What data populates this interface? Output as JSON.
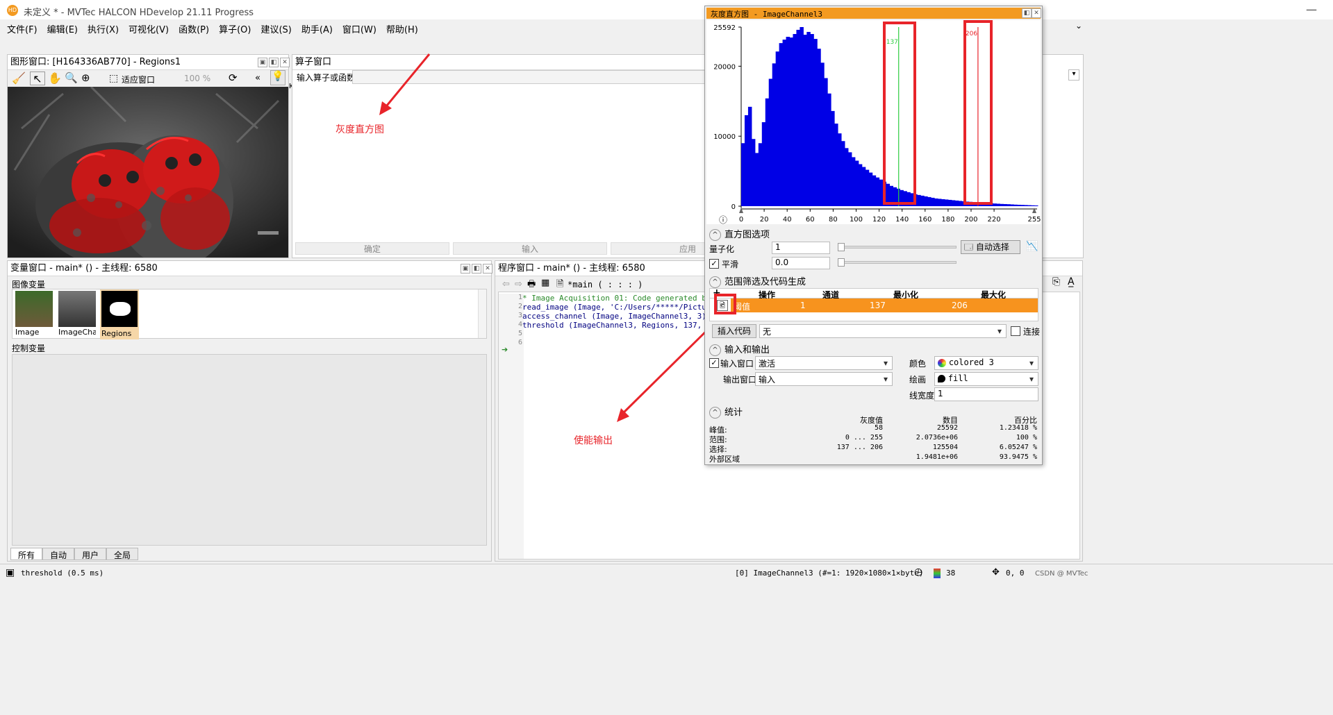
{
  "app": {
    "title": "未定义 * - MVTec HALCON HDevelop 21.11 Progress",
    "logo": "HD"
  },
  "menu": [
    "文件(F)",
    "编辑(E)",
    "执行(X)",
    "可视化(V)",
    "函数(P)",
    "算子(O)",
    "建议(S)",
    "助手(A)",
    "窗口(W)",
    "帮助(H)"
  ],
  "graphics": {
    "title": "图形窗口: [H164336AB770] - Regions1",
    "fit": "适应窗口",
    "zoom": "100 %",
    "more": "«"
  },
  "operator": {
    "title": "算子窗口",
    "input_label": "输入算子或函数",
    "buttons": [
      "确定",
      "输入",
      "应用"
    ]
  },
  "annotations": {
    "histogram": "灰度直方图",
    "output": "使能输出"
  },
  "variables": {
    "title": "变量窗口 - main* () - 主线程: 6580",
    "image_section": "图像变量",
    "control_section": "控制变量",
    "thumbs": [
      "Image",
      "ImageCha",
      "Regions"
    ],
    "tabs": [
      "所有",
      "自动",
      "用户",
      "全局"
    ]
  },
  "program": {
    "title": "程序窗口 - main* () - 主线程: 6580",
    "proc": "*main ( : : : )",
    "line_numbers": [
      "1",
      "2",
      "3",
      "4",
      "5",
      "6"
    ],
    "lines": [
      "* Image Acquisition 01: Code generated by Imag",
      "read_image (Image, 'C:/Users/*****/Pictures/C",
      "access_channel (Image, ImageChannel3, 3)",
      "threshold (ImageChannel3, Regions, 137, 206)",
      "",
      ""
    ]
  },
  "status": {
    "left": "threshold (0.5 ms)",
    "image_info": "[0] ImageChannel3 (#=1: 1920×1080×1×byte)",
    "value": "38",
    "coords": "0, 0",
    "watermark": "CSDN @ MVTec"
  },
  "histogram": {
    "title": "灰度直方图 - ImageChannel3",
    "y_ticks": [
      "25592",
      "20000",
      "10000",
      "0"
    ],
    "x_ticks": [
      "0",
      "20",
      "40",
      "60",
      "80",
      "100",
      "120",
      "140",
      "160",
      "180",
      "200",
      "220",
      "255"
    ],
    "min_marker": "137",
    "max_marker": "206",
    "options": {
      "section": "直方图选项",
      "quant_label": "量子化",
      "quant_value": "1",
      "smooth_label": "平滑",
      "smooth_value": "0.0",
      "auto_select": "自动选择"
    },
    "range": {
      "section": "范围筛选及代码生成",
      "plus": "+",
      "headers": [
        "操作",
        "通道",
        "最小化",
        "最大化"
      ],
      "row": [
        "阈值",
        "1",
        "137",
        "206"
      ],
      "insert_code": "插入代码",
      "insert_value": "无",
      "connect": "连接"
    },
    "io": {
      "section": "输入和输出",
      "input_win_label": "输入窗口",
      "input_win_value": "激活",
      "output_win_label": "输出窗口",
      "output_win_value": "输入",
      "color_label": "颜色",
      "color_value": "colored 3",
      "draw_label": "绘画",
      "draw_value": "fill",
      "linewidth_label": "线宽度",
      "linewidth_value": "1"
    },
    "stats": {
      "section": "统计",
      "headers": [
        "灰度值",
        "数目",
        "百分比"
      ],
      "rows": [
        {
          "label": "峰值:",
          "gray": "58",
          "count": "25592",
          "pct": "1.23418 %"
        },
        {
          "label": "范围:",
          "gray": "0 ... 255",
          "count": "2.0736e+06",
          "pct": "100 %"
        },
        {
          "label": "选择:",
          "gray": "137 ... 206",
          "count": "125504",
          "pct": "6.05247 %"
        },
        {
          "label": "外部区域",
          "gray": "",
          "count": "1.9481e+06",
          "pct": "93.9475 %"
        }
      ]
    }
  },
  "colors": {
    "accent": "#f39a21",
    "bars": "#0000e6",
    "red": "#e8242a",
    "selection": "#f7931e"
  },
  "chart_data": {
    "type": "bar",
    "title": "灰度直方图 - ImageChannel3",
    "xlim": [
      0,
      255
    ],
    "ylim": [
      0,
      25592
    ],
    "x": [
      0,
      3,
      6,
      9,
      12,
      15,
      18,
      21,
      24,
      27,
      30,
      33,
      36,
      39,
      42,
      45,
      48,
      51,
      54,
      57,
      60,
      63,
      66,
      69,
      72,
      75,
      78,
      81,
      84,
      87,
      90,
      93,
      96,
      99,
      102,
      105,
      108,
      111,
      114,
      117,
      120,
      123,
      126,
      129,
      132,
      135,
      138,
      141,
      144,
      147,
      150,
      153,
      156,
      159,
      162,
      165,
      168,
      171,
      174,
      177,
      180,
      183,
      186,
      189,
      192,
      195,
      198,
      201,
      204,
      207,
      210,
      213,
      216,
      219,
      222,
      225,
      228,
      231,
      234,
      237,
      240,
      243,
      246,
      249,
      252,
      255
    ],
    "values": [
      9000,
      13000,
      14200,
      9600,
      7600,
      9000,
      12000,
      15400,
      18200,
      20400,
      22100,
      23300,
      23800,
      24200,
      24100,
      24600,
      25200,
      25592,
      24500,
      24900,
      24600,
      23900,
      22500,
      20500,
      18300,
      16100,
      13600,
      11800,
      10400,
      9300,
      8300,
      7700,
      7000,
      6500,
      6000,
      5600,
      5200,
      4800,
      4400,
      4100,
      3800,
      3500,
      3200,
      2900,
      2700,
      2500,
      2300,
      2150,
      2000,
      1850,
      1700,
      1600,
      1500,
      1400,
      1300,
      1200,
      1100,
      1050,
      1000,
      950,
      900,
      850,
      800,
      750,
      700,
      650,
      620,
      580,
      550,
      520,
      480,
      450,
      420,
      380,
      350,
      320,
      300,
      280,
      250,
      220,
      200,
      180,
      160,
      140,
      120,
      100
    ],
    "markers": {
      "min": 137,
      "max": 206
    }
  }
}
